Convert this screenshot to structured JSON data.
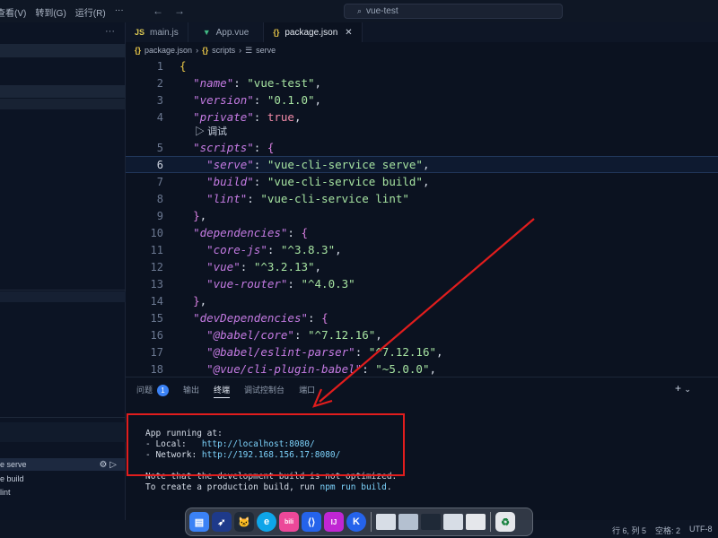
{
  "titlebar": {
    "menu": [
      "查看(V)",
      "转到(G)",
      "运行(R)",
      "···"
    ],
    "search_text": "vue-test"
  },
  "tabs": [
    {
      "label": "main.js",
      "icon": "JS",
      "active": false
    },
    {
      "label": "App.vue",
      "icon": "▼",
      "active": false
    },
    {
      "label": "package.json",
      "icon": "{}",
      "active": true
    }
  ],
  "breadcrumb": {
    "file": "package.json",
    "section": "scripts",
    "item": "serve"
  },
  "editor": {
    "debug_label": "调试",
    "current_line": 6
  },
  "panel": {
    "tabs": [
      "问题",
      "输出",
      "终端",
      "调试控制台",
      "端口"
    ],
    "problems_count": "1",
    "active_tab": "终端",
    "terminal": {
      "line1": "App running at:",
      "local_label": "- Local:   ",
      "local_url": "http://localhost:8080/",
      "network_label": "- Network: ",
      "network_url": "http://192.168.156.17:8080/",
      "note": "Note that the development build is not optimized.",
      "build_prefix": "To create a production build, run ",
      "build_cmd": "npm run build",
      "build_suffix": "."
    }
  },
  "npm_scripts": {
    "serve": "e serve",
    "build": "e build",
    "lint": "lint"
  },
  "statusbar": {
    "position": "行 6, 列 5",
    "spaces": "空格: 2",
    "encoding": "UTF-8"
  },
  "colors": {
    "highlight_box": "#e11d1d",
    "arrow": "#e11d1d"
  }
}
